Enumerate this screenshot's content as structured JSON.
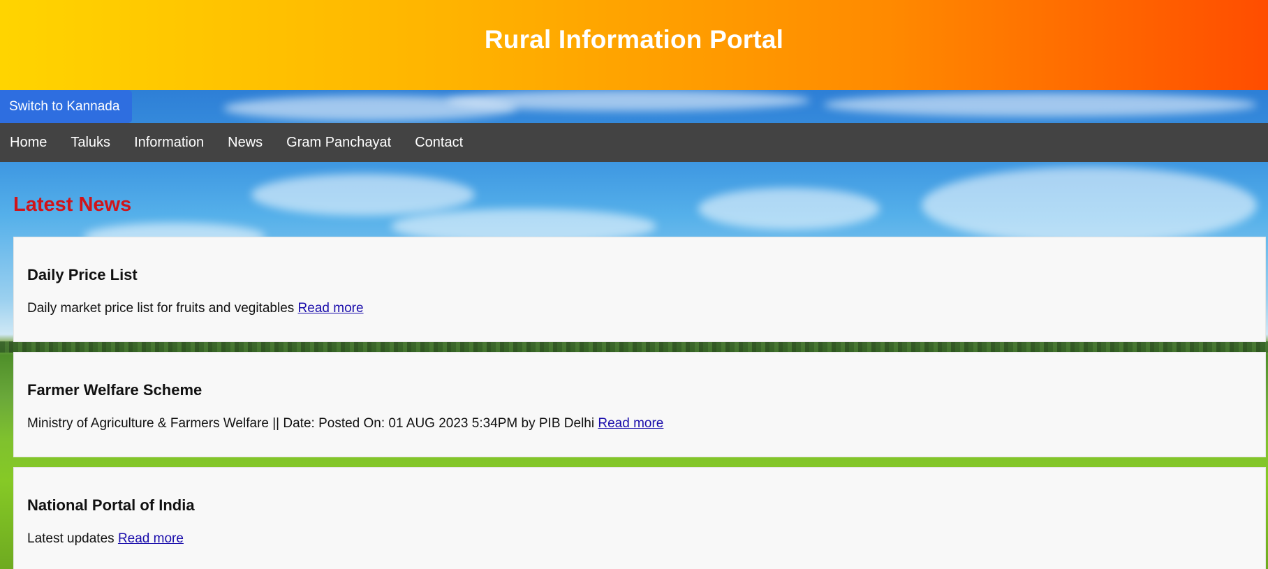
{
  "header": {
    "title": "Rural Information Portal"
  },
  "language_toggle": {
    "label": "Switch to Kannada"
  },
  "nav": {
    "items": [
      {
        "label": "Home"
      },
      {
        "label": "Taluks"
      },
      {
        "label": "Information"
      },
      {
        "label": "News"
      },
      {
        "label": "Gram Panchayat"
      },
      {
        "label": "Contact"
      }
    ]
  },
  "main": {
    "section_title": "Latest News",
    "news": [
      {
        "title": "Daily Price List",
        "description": "Daily market price list for fruits and vegitables",
        "link_label": "Read more"
      },
      {
        "title": "Farmer Welfare Scheme",
        "description": "Ministry of Agriculture & Farmers Welfare || Date: Posted On: 01 AUG 2023 5:34PM by PIB Delhi",
        "link_label": "Read more"
      },
      {
        "title": "National Portal of India",
        "description": "Latest updates",
        "link_label": "Read more"
      }
    ]
  },
  "colors": {
    "header_gradient": [
      "#ffd400",
      "#ffb400",
      "#ff8a00",
      "#ff4d00"
    ],
    "nav_background": "#434343",
    "language_button": "#2e6ee0",
    "section_title": "#d0141a",
    "card_background": "#f8f8f8",
    "link": "#1a0dab"
  }
}
